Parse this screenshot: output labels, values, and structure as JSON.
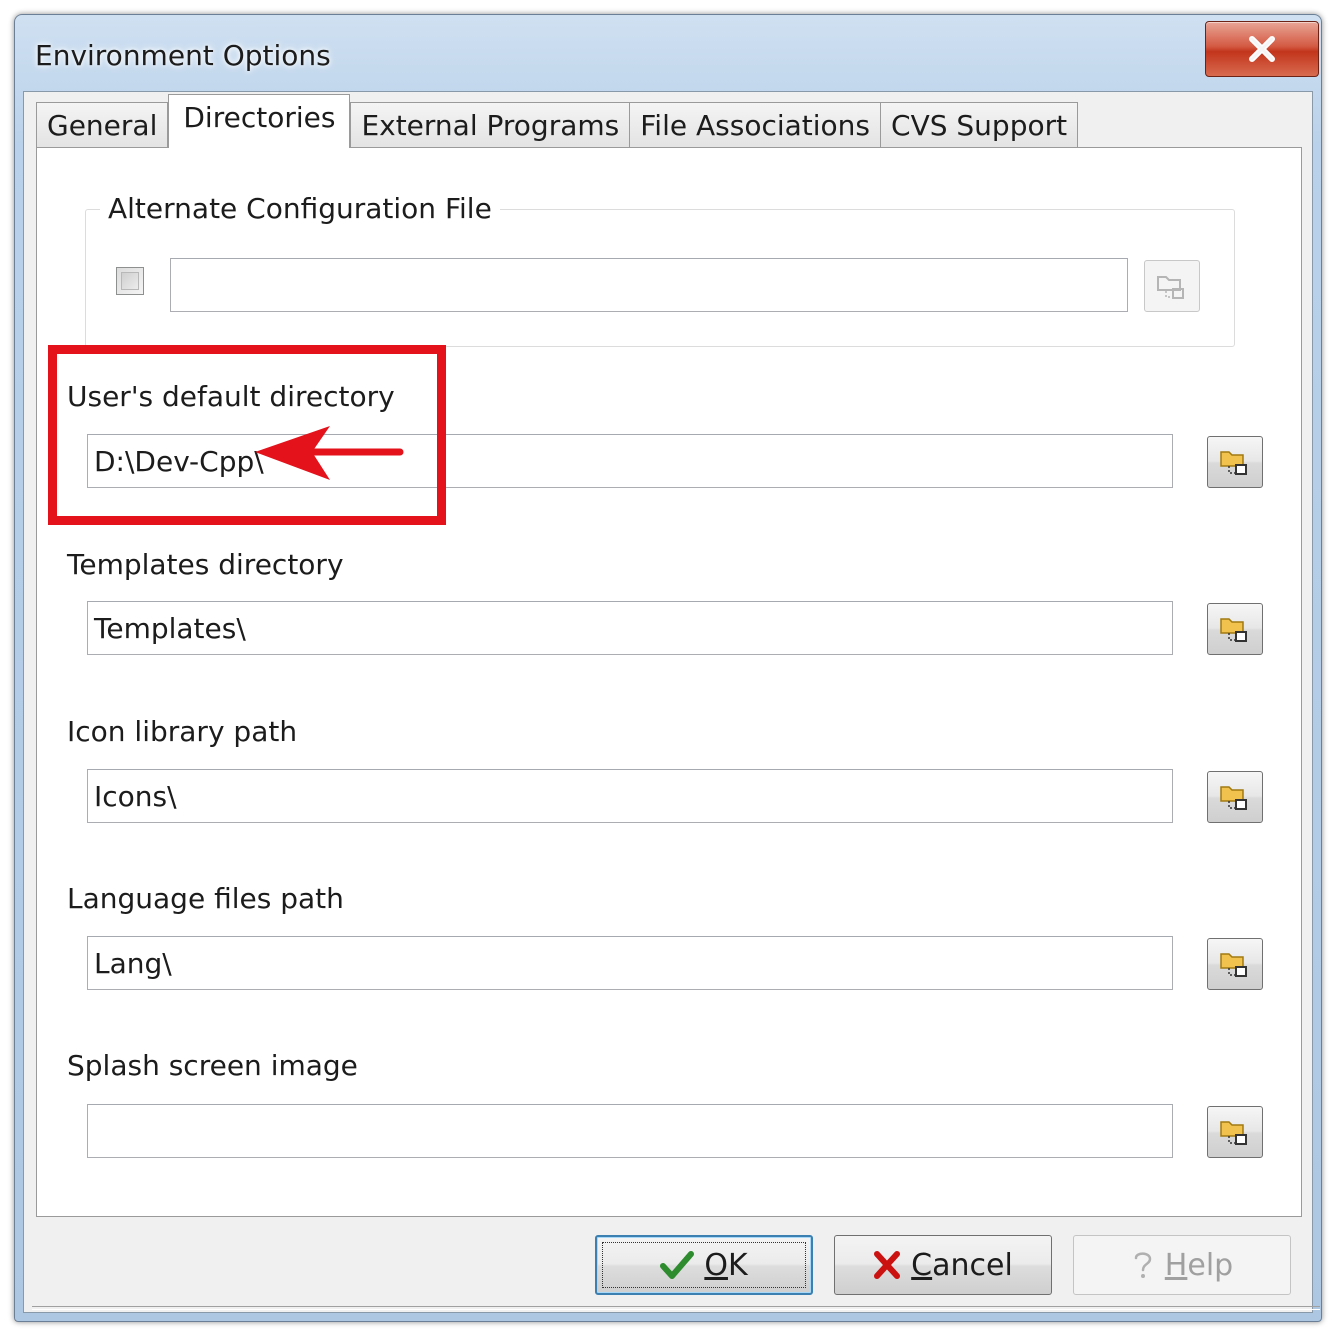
{
  "window": {
    "title": "Environment Options",
    "close_glyph": "X"
  },
  "tabs": [
    {
      "label": "General",
      "active": false
    },
    {
      "label": "Directories",
      "active": true
    },
    {
      "label": "External Programs",
      "active": false
    },
    {
      "label": "File Associations",
      "active": false
    },
    {
      "label": "CVS Support",
      "active": false
    }
  ],
  "alt_config": {
    "group_label": "Alternate Configuration File",
    "checked": false,
    "value": ""
  },
  "fields": {
    "user_default_dir": {
      "label": "User's default directory",
      "value": "D:\\Dev-Cpp\\"
    },
    "templates_dir": {
      "label": "Templates directory",
      "value": "Templates\\"
    },
    "icon_library": {
      "label": "Icon library path",
      "value": "Icons\\"
    },
    "language_files": {
      "label": "Language files path",
      "value": "Lang\\"
    },
    "splash_image": {
      "label": "Splash screen image",
      "value": ""
    }
  },
  "buttons": {
    "ok": {
      "mnemonic": "O",
      "rest": "K"
    },
    "cancel": {
      "mnemonic": "C",
      "rest": "ancel"
    },
    "help": {
      "mnemonic": "H",
      "rest": "elp",
      "enabled": false
    }
  },
  "icons": {
    "browse": "folder-browse-icon",
    "ok": "checkmark-icon",
    "cancel": "red-x-icon",
    "help": "question-mark-icon"
  },
  "colors": {
    "highlight": "#e3121b",
    "ok_check": "#2e8b2e",
    "cancel_x": "#cc1111",
    "close_button": "#c2351c"
  }
}
